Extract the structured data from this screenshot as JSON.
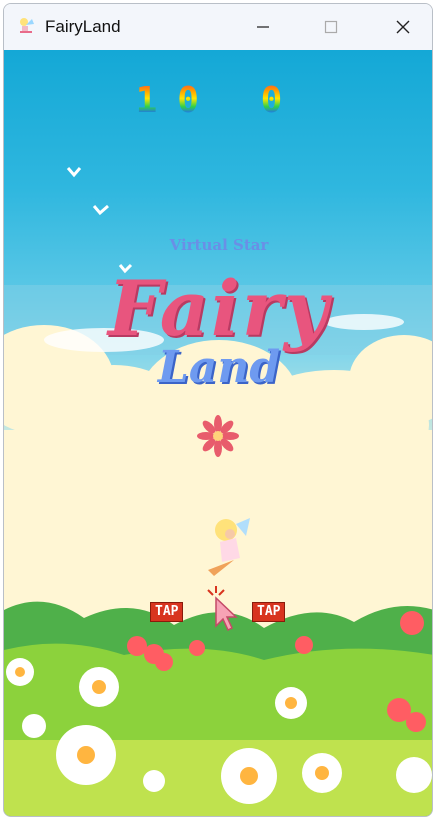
{
  "window": {
    "title": "FairyLand"
  },
  "game": {
    "score_left": "10",
    "score_right": "0",
    "subtitle": "Virtual Star",
    "title_main": "Fairy",
    "title_sub": "Land",
    "tap_left": "TAP",
    "tap_right": "TAP"
  },
  "colors": {
    "sky_top": "#14a8d6",
    "title_pink": "#e8557e",
    "title_blue": "#6e9af0",
    "tap_red": "#d8341f",
    "grass": "#8cd23c"
  }
}
